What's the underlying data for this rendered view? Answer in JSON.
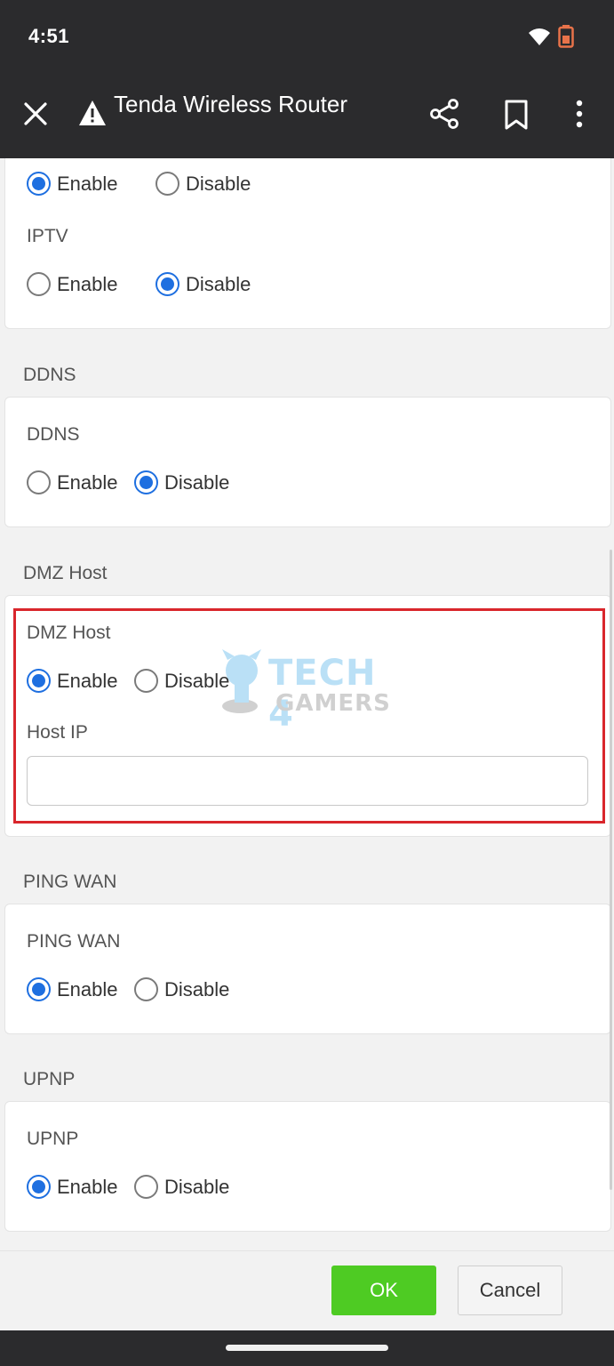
{
  "status_bar": {
    "time": "4:51"
  },
  "app_bar": {
    "title": "Tenda Wireless Router"
  },
  "options": {
    "enable": "Enable",
    "disable": "Disable"
  },
  "sections": {
    "top_partial": {
      "selected": "enable"
    },
    "iptv": {
      "label": "IPTV",
      "selected": "disable"
    },
    "ddns": {
      "title": "DDNS",
      "label": "DDNS",
      "selected": "disable"
    },
    "dmz": {
      "title": "DMZ Host",
      "label": "DMZ Host",
      "selected": "enable",
      "host_ip_label": "Host IP",
      "host_ip_value": ""
    },
    "ping_wan": {
      "title": "PING WAN",
      "label": "PING WAN",
      "selected": "enable"
    },
    "upnp": {
      "title": "UPNP",
      "label": "UPNP",
      "selected": "enable"
    }
  },
  "watermark": {
    "line1": "TECH 4",
    "line2": "GAMERS"
  },
  "footer": {
    "ok_label": "OK",
    "cancel_label": "Cancel"
  },
  "colors": {
    "accent": "#1e6fe0",
    "ok_green": "#4ecb23",
    "highlight_red": "#d9262c",
    "bar_dark": "#2b2b2d"
  }
}
